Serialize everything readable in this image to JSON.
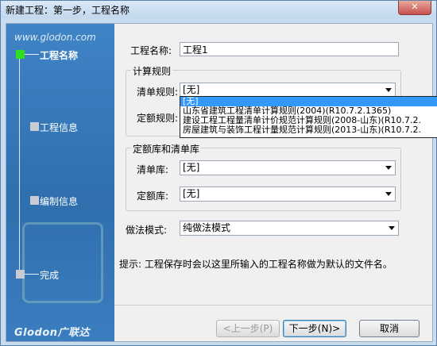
{
  "window": {
    "title": "新建工程：第一步，工程名称",
    "close_icon": "close-icon"
  },
  "sidebar": {
    "site": "www.glodon.com",
    "logo": "Glodon广联达",
    "steps": [
      {
        "label": "工程名称",
        "active": true
      },
      {
        "label": "工程信息",
        "active": false
      },
      {
        "label": "编制信息",
        "active": false
      },
      {
        "label": "完成",
        "active": false
      }
    ],
    "colors": {
      "active_step": "#2ee01d",
      "panel": "#3175b8"
    }
  },
  "form": {
    "project_name_label": "工程名称:",
    "project_name_value": "工程1",
    "calc_rules_title": "计算规则",
    "bill_rule_label": "清单规则:",
    "bill_rule_value": "[无]",
    "quota_rule_label": "定额规则:",
    "lib_title": "定额库和清单库",
    "bill_lib_label": "清单库:",
    "bill_lib_value": "[无]",
    "quota_lib_label": "定额库:",
    "quota_lib_value": "[无]",
    "method_label": "做法模式:",
    "method_value": "纯做法模式",
    "hint": "提示: 工程保存时会以这里所输入的工程名称做为默认的文件名。"
  },
  "dropdown_options": [
    "[无]",
    "山东省建筑工程清单计算规则(2004)(R10.7.2.1365)",
    "建设工程工程量清单计价规范计算规则(2008-山东)(R10.7.2.",
    "房屋建筑与装饰工程计量规范计算规则(2013-山东)(R10.7.2."
  ],
  "buttons": {
    "prev": "<上一步(P)",
    "next": "下一步(N)>",
    "cancel": "取消"
  }
}
